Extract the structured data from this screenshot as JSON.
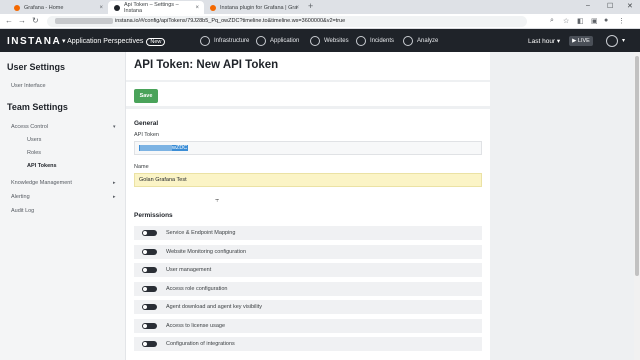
{
  "browser": {
    "tabs": [
      {
        "title": "Grafana - Home",
        "fav_color": "#f46800"
      },
      {
        "title": "Api Token – Settings – Instana",
        "fav_color": "#1f2329"
      },
      {
        "title": "Instana plugin for Grafana | Gra",
        "fav_color": "#f46800"
      }
    ],
    "url": "instana.io/#/config/apiTokens/79J28b5_Pq_owZDC?timeline.to&timeline.ws=3600000&v2=true",
    "new_tab": "+"
  },
  "nav": {
    "logo": "INSTANA",
    "app_perspectives": "Application Perspectives",
    "new_badge": "New",
    "items": [
      {
        "label": "Infrastructure",
        "icon": "infrastructure-icon"
      },
      {
        "label": "Application",
        "icon": "application-icon"
      },
      {
        "label": "Websites",
        "icon": "globe-icon"
      },
      {
        "label": "Incidents",
        "icon": "incident-icon"
      },
      {
        "label": "Analyze",
        "icon": "analyze-icon"
      }
    ],
    "time": "Last hour",
    "live": "LIVE"
  },
  "sidebar": {
    "user_settings": "User Settings",
    "user_interface": "User Interface",
    "team_settings": "Team Settings",
    "access_control": "Access Control",
    "users": "Users",
    "roles": "Roles",
    "api_tokens": "API Tokens",
    "knowledge_management": "Knowledge Management",
    "alerting": "Alerting",
    "audit_log": "Audit Log"
  },
  "page": {
    "title": "API Token: New API Token",
    "save": "Save",
    "general": "General",
    "api_token_label": "API Token",
    "api_token_visible_suffix": "wZDC",
    "name_label": "Name",
    "name_value": "Golan Grafana Test",
    "permissions": "Permissions",
    "perms": [
      "Service & Endpoint Mapping",
      "Website Monitoring configuration",
      "User management",
      "Access role configuration",
      "Agent download and agent key visibility",
      "Access to license usage",
      "Configuration of integrations"
    ]
  }
}
